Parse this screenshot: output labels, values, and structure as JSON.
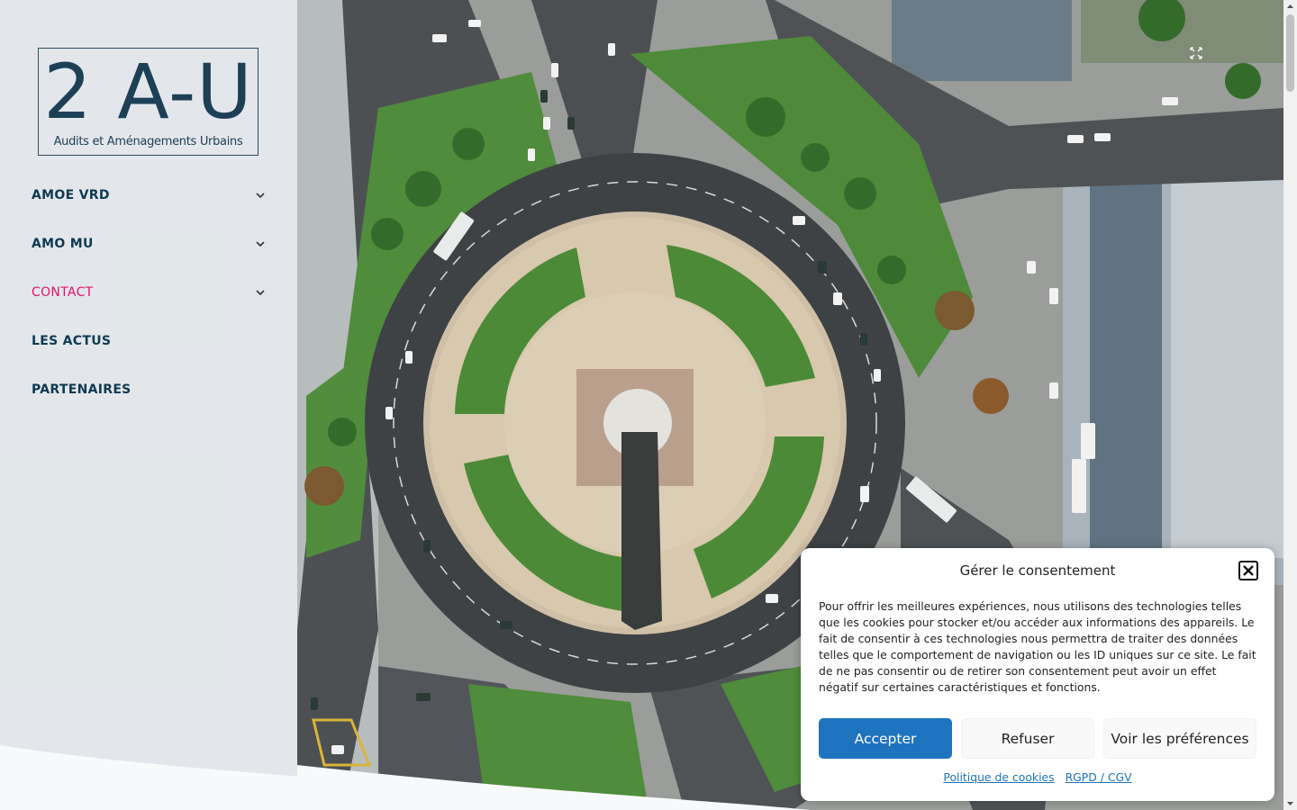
{
  "brand": {
    "logo_text": "2 A-U",
    "tagline": "Audits et Aménagements Urbains",
    "primary_color": "#1d4056",
    "active_color": "#e2165f"
  },
  "nav": {
    "items": [
      {
        "label": "AMOE VRD",
        "has_submenu": true,
        "active": false
      },
      {
        "label": "AMO MU",
        "has_submenu": true,
        "active": false
      },
      {
        "label": "CONTACT",
        "has_submenu": true,
        "active": true
      },
      {
        "label": "LES ACTUS",
        "has_submenu": false,
        "active": false
      },
      {
        "label": "PARTENAIRES",
        "has_submenu": false,
        "active": false
      }
    ]
  },
  "hero": {
    "icon": "fullscreen-icon"
  },
  "consent": {
    "title": "Gérer le consentement",
    "body": "Pour offrir les meilleures expériences, nous utilisons des technologies telles que les cookies pour stocker et/ou accéder aux informations des appareils. Le fait de consentir à ces technologies nous permettra de traiter des données telles que le comportement de navigation ou les ID uniques sur ce site. Le fait de ne pas consentir ou de retirer son consentement peut avoir un effet négatif sur certaines caractéristiques et fonctions.",
    "accept_label": "Accepter",
    "refuse_label": "Refuser",
    "prefs_label": "Voir les préférences",
    "link_cookies": "Politique de cookies",
    "link_rgpd": "RGPD / CGV",
    "accent_color": "#1e73be"
  }
}
